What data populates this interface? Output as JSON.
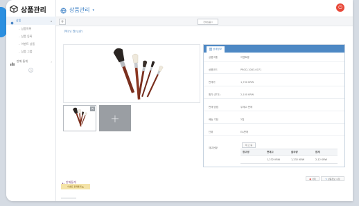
{
  "app": {
    "brand": "상품관리"
  },
  "header": {
    "title": "상품관리",
    "caret": "▾",
    "logout_glyph": "⏻"
  },
  "sidebar": {
    "section": {
      "label": "상품",
      "chevron": "▾"
    },
    "items": [
      {
        "label": "상품목록"
      },
      {
        "label": "상품 등록"
      },
      {
        "label": "이벤트 상품"
      },
      {
        "label": "상품 그룹"
      }
    ],
    "section2": {
      "label": "판매 통계",
      "chevron": "›"
    },
    "mini": "○"
  },
  "toolbar": {
    "add": "+",
    "center": "전체상품 ▾"
  },
  "product": {
    "name": "Mini Brush"
  },
  "thumb": {
    "delete": "✕"
  },
  "add_tile": "+",
  "info": {
    "tab_label": "상세정보",
    "rows": [
      {
        "label": "상품그룹",
        "value": "이벤트용"
      },
      {
        "label": "상품코드",
        "value": "PROD-1083-0071"
      },
      {
        "label": "판매가",
        "value": "1,700 KRW"
      },
      {
        "label": "원가 (부가)",
        "value": "2,100 KRW"
      },
      {
        "label": "판매 방법",
        "value": "무재고 판매"
      },
      {
        "label": "배송 기한",
        "value": "2일"
      },
      {
        "label": "단위",
        "value": "EA판매"
      }
    ],
    "stock_label": "재고현황",
    "stock_button": "재 고 등",
    "stock_table": {
      "headers": [
        "창고명",
        "현재고",
        "출주량",
        "합계"
      ],
      "rows": [
        [
          "",
          "1,232 KRW",
          "1,232 KRW",
          "2,12 KRW"
        ]
      ]
    }
  },
  "stats": {
    "title": "판매통계",
    "badge": "이벤트 판매통계 ▲"
  },
  "actions": {
    "delete": "삭제",
    "edit": "상품정보 수정"
  },
  "colors": {
    "accent": "#4d88c4",
    "danger": "#e8493a",
    "tab": "#2b8fe0"
  }
}
